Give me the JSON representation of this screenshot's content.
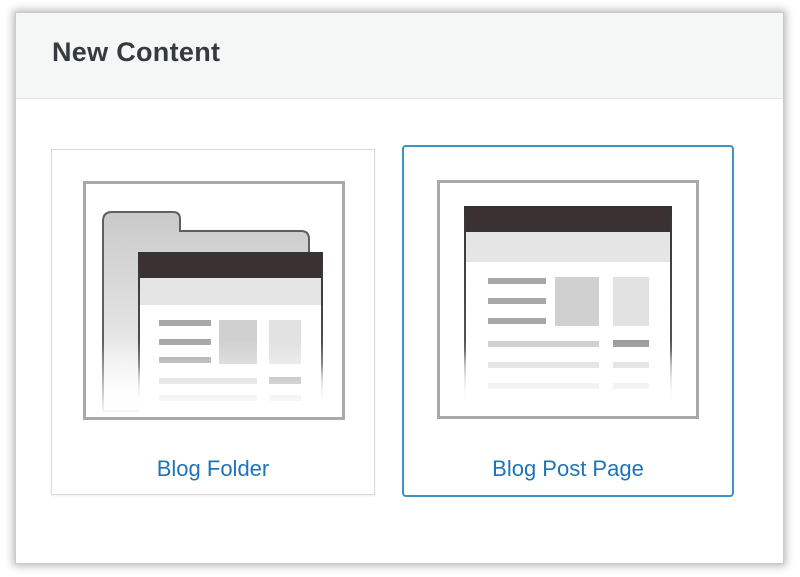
{
  "dialog": {
    "title": "New Content"
  },
  "options": [
    {
      "label": "Blog Folder",
      "icon": "blog-folder-icon",
      "selected": false
    },
    {
      "label": "Blog Post Page",
      "icon": "blog-post-page-icon",
      "selected": true
    }
  ],
  "colors": {
    "header_bg": "#f5f6f6",
    "title_text": "#333a40",
    "link_text": "#1f73b6",
    "selected_border": "#3c94c6",
    "page_header_dark": "#3a3232"
  }
}
